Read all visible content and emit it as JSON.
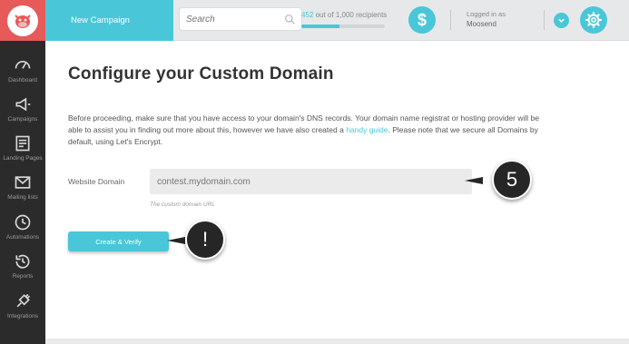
{
  "sidebar": {
    "items": [
      {
        "label": "Dashboard",
        "icon": "gauge-icon"
      },
      {
        "label": "Campaigns",
        "icon": "megaphone-icon"
      },
      {
        "label": "Landing Pages",
        "icon": "landing-page-icon"
      },
      {
        "label": "Mailing lists",
        "icon": "envelope-icon"
      },
      {
        "label": "Automations",
        "icon": "clock-icon"
      },
      {
        "label": "Reports",
        "icon": "history-clock-icon"
      },
      {
        "label": "Integrations",
        "icon": "plug-icon"
      }
    ]
  },
  "header": {
    "new_campaign": "New Campaign",
    "search_placeholder": "Search",
    "recipients_count": "452",
    "recipients_text": " out of 1,000 recipients",
    "recipients_fraction": 0.452,
    "billing_symbol": "$",
    "logged_in_label": "Logged in as",
    "user_name": "Moosend"
  },
  "main": {
    "title": "Configure your Custom Domain",
    "description_part1": "Before proceeding, make sure that you have access to your domain's DNS records. Your domain name registrat or hosting provider will be able to assist you in finding out more about this, however we have also created a ",
    "description_link": "handy guide",
    "description_part2": ". Please note that we secure all Domains by default, using Let's Encrypt.",
    "website_domain_label": "Website Domain",
    "website_domain_placeholder": "contest.mydomain.com",
    "hint": "The custom domain URL",
    "create_verify_label": "Create & Verify"
  },
  "callouts": {
    "step": "5",
    "alert": "!"
  },
  "colors": {
    "accent": "#49c7d8",
    "sidebar": "#2b2b2b",
    "logo_bg": "#e65a5a",
    "callout": "#262626"
  }
}
